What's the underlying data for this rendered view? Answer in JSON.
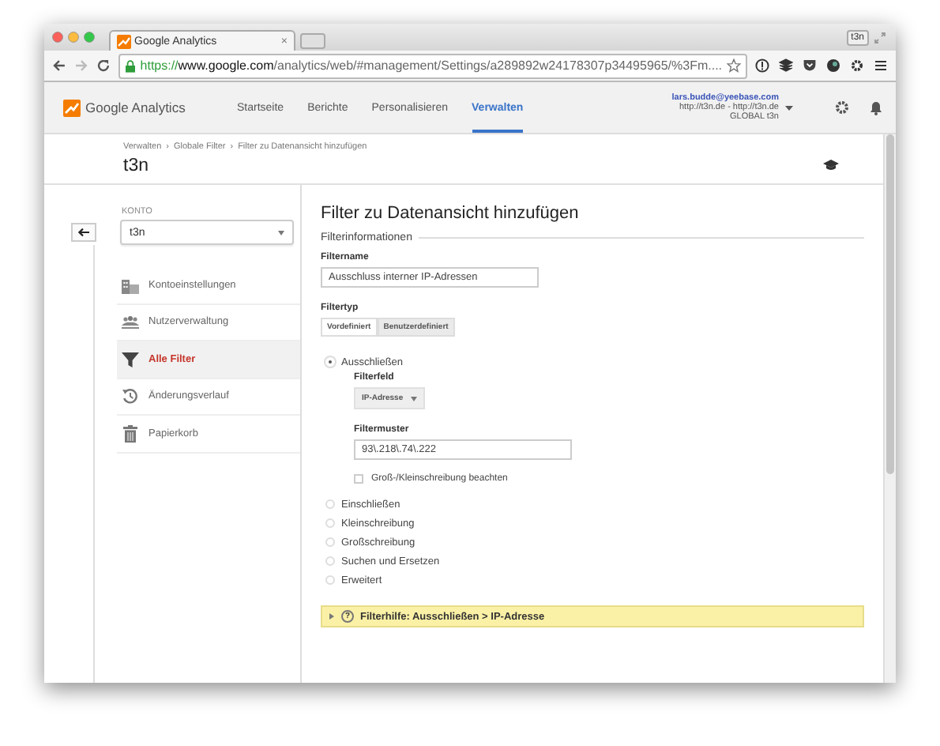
{
  "browser": {
    "tab_title": "Google Analytics",
    "tab_close": "×",
    "profile": "t3n",
    "url_scheme": "https://",
    "url_host": "www.google.com",
    "url_path": "/analytics/web/#management/Settings/a289892w24178307p34495965/%3Fm...."
  },
  "header": {
    "brand": "Google Analytics",
    "nav": [
      {
        "label": "Startseite",
        "selected": false
      },
      {
        "label": "Berichte",
        "selected": false
      },
      {
        "label": "Personalisieren",
        "selected": false
      },
      {
        "label": "Verwalten",
        "selected": true
      }
    ],
    "account": {
      "email": "lars.budde@yeebase.com",
      "sites": "http://t3n.de - http://t3n.de",
      "view": "GLOBAL t3n"
    }
  },
  "page": {
    "breadcrumbs": [
      "Verwalten",
      "Globale Filter",
      "Filter zu Datenansicht hinzufügen"
    ],
    "separator": "›",
    "title": "t3n"
  },
  "sidebar": {
    "account_label": "KONTO",
    "account_value": "t3n",
    "items": [
      {
        "label": "Kontoeinstellungen",
        "kind": "building",
        "selected": false
      },
      {
        "label": "Nutzerverwaltung",
        "kind": "people",
        "selected": false
      },
      {
        "label": "Alle Filter",
        "kind": "filter",
        "selected": true
      },
      {
        "label": "Änderungsverlauf",
        "kind": "history",
        "selected": false
      },
      {
        "label": "Papierkorb",
        "kind": "trash",
        "selected": false
      }
    ]
  },
  "form": {
    "title": "Filter zu Datenansicht hinzufügen",
    "section": "Filterinformationen",
    "filter_name_label": "Filtername",
    "filter_name_value": "Ausschluss interner IP-Adressen",
    "filter_type_label": "Filtertyp",
    "type_tabs": [
      {
        "label": "Vordefiniert",
        "selected": false
      },
      {
        "label": "Benutzerdefiniert",
        "selected": true
      }
    ],
    "options": [
      {
        "label": "Ausschließen",
        "selected": true
      },
      {
        "label": "Einschließen",
        "selected": false
      },
      {
        "label": "Kleinschreibung",
        "selected": false
      },
      {
        "label": "Großschreibung",
        "selected": false
      },
      {
        "label": "Suchen und Ersetzen",
        "selected": false
      },
      {
        "label": "Erweitert",
        "selected": false
      }
    ],
    "filter_field_label": "Filterfeld",
    "filter_field_value": "IP-Adresse",
    "pattern_label": "Filtermuster",
    "pattern_value": "93\\.218\\.74\\.222",
    "case_checkbox": {
      "label": "Groß-/Kleinschreibung beachten",
      "checked": false
    },
    "help": {
      "mark": "?",
      "label": "Filterhilfe: Ausschließen > IP-Adresse",
      "expanded": false
    }
  }
}
